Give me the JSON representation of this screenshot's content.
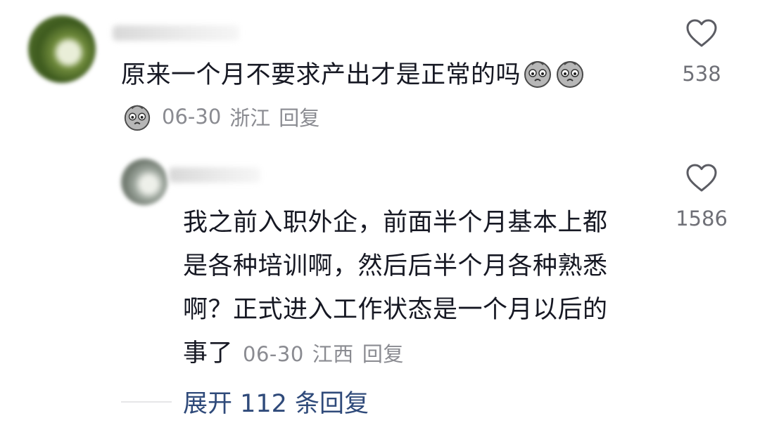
{
  "comment": {
    "text": "原来一个月不要求产出才是正常的吗",
    "emojis": [
      "sad-face-emoji",
      "sad-face-emoji"
    ],
    "date": "06-30",
    "location": "浙江",
    "reply_label": "回复",
    "likes": "538",
    "meta_emoji": "sad-face-emoji"
  },
  "reply": {
    "lines": [
      "我之前入职外企，前面半个月基本上都",
      "是各种培训啊，然后后半个月各种熟悉",
      "啊？正式进入工作状态是一个月以后的",
      "事了"
    ],
    "date": "06-30",
    "location": "江西",
    "reply_label": "回复",
    "likes": "1586"
  },
  "expand": {
    "label": "展开 112 条回复"
  },
  "colors": {
    "text": "#161823",
    "meta": "#8a8b91",
    "link": "#2f4a7a"
  }
}
